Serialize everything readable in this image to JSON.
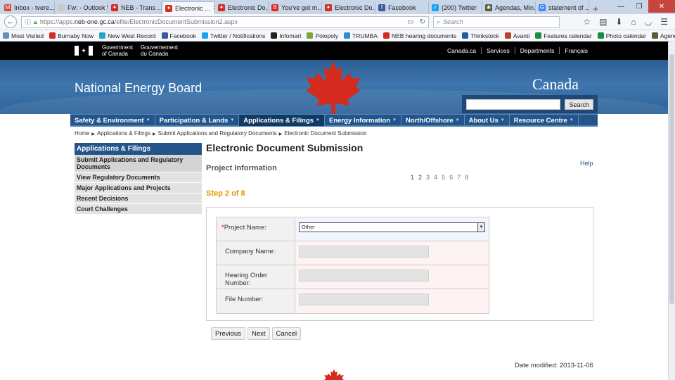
{
  "browser": {
    "tabs": [
      {
        "label": "Inbox - tvere...",
        "fav": "gmail",
        "color": "#d44638",
        "glyph": "M"
      },
      {
        "label": "Fw: - Outlook We...",
        "fav": "outlook",
        "color": "#c9c9c9",
        "glyph": ""
      },
      {
        "label": "NEB - Trans ...",
        "fav": "maple-leaf",
        "color": "#d52b1e",
        "glyph": "✦"
      },
      {
        "label": "Electronic ...",
        "fav": "maple-leaf",
        "color": "#d52b1e",
        "glyph": "✦",
        "active": true
      },
      {
        "label": "Electronic Do...",
        "fav": "maple-leaf",
        "color": "#d52b1e",
        "glyph": "✦"
      },
      {
        "label": "You've got m...",
        "fav": "mail",
        "color": "#d52b1e",
        "glyph": "B"
      },
      {
        "label": "Electronic Do...",
        "fav": "maple-leaf",
        "color": "#d52b1e",
        "glyph": "✦"
      },
      {
        "label": "Facebook",
        "fav": "facebook",
        "color": "#3b5998",
        "glyph": "f"
      },
      {
        "label": "(200) Twitter",
        "fav": "twitter",
        "color": "#1da1f2",
        "glyph": "✓"
      },
      {
        "label": "Agendas, Min...",
        "fav": "agenda",
        "color": "#5a5a3a",
        "glyph": "❀"
      },
      {
        "label": "statement of ...",
        "fav": "google",
        "color": "#4285f4",
        "glyph": "G"
      }
    ],
    "url_prefix": "https://apps.",
    "url_host": "neb-one.gc.ca",
    "url_path": "/efile/ElectronicDocumentSubmission2.aspx",
    "search_placeholder": "Search",
    "bookmarks": [
      {
        "label": "Most Visited",
        "color": "#6b8cba"
      },
      {
        "label": "Burnaby Now",
        "color": "#d52b1e"
      },
      {
        "label": "New West Record",
        "color": "#2aa0c4"
      },
      {
        "label": "Facebook",
        "color": "#3b5998"
      },
      {
        "label": "Twitter / Notifications",
        "color": "#1da1f2"
      },
      {
        "label": "Infomart",
        "color": "#222222"
      },
      {
        "label": "Polopoly",
        "color": "#7aa83a"
      },
      {
        "label": "TRUMBA",
        "color": "#2f8fce"
      },
      {
        "label": "NEB hearing documents",
        "color": "#d52b1e"
      },
      {
        "label": "Thinkstock",
        "color": "#1a5fa8"
      },
      {
        "label": "Avanti",
        "color": "#b5452d"
      },
      {
        "label": "Features calendar",
        "color": "#1e8c3a"
      },
      {
        "label": "Photo calendar",
        "color": "#1e8c3a"
      },
      {
        "label": "Agendas, Minutes & R...",
        "color": "#5a5a3a"
      }
    ]
  },
  "gc": {
    "gov_en_1": "Government",
    "gov_en_2": "of Canada",
    "gov_fr_1": "Gouvernement",
    "gov_fr_2": "du Canada",
    "links": [
      "Canada.ca",
      "Services",
      "Departments",
      "Français"
    ]
  },
  "site": {
    "title": "National Energy Board",
    "wordmark": "Canada",
    "search_button": "Search"
  },
  "menu": [
    {
      "label": "Safety & Environment",
      "active": false
    },
    {
      "label": "Participation & Lands",
      "active": false
    },
    {
      "label": "Applications & Filings",
      "active": true
    },
    {
      "label": "Energy Information",
      "active": false
    },
    {
      "label": "North/Offshore",
      "active": false
    },
    {
      "label": "About Us",
      "active": false
    },
    {
      "label": "Resource Centre",
      "active": false
    }
  ],
  "breadcrumb": [
    "Home",
    "Applications & Filings",
    "Submit Applications and Regulatory Documents",
    "Electronic Document Submission"
  ],
  "leftnav": {
    "heading": "Applications & Filings",
    "items": [
      {
        "label": "Submit Applications and Regulatory Documents",
        "current": true
      },
      {
        "label": "View Regulatory Documents"
      },
      {
        "label": "Major Applications and Projects"
      },
      {
        "label": "Recent Decisions"
      },
      {
        "label": "Court Challenges"
      }
    ]
  },
  "page": {
    "title": "Electronic Document Submission",
    "section": "Project Information",
    "help": "Help",
    "pages": [
      "1",
      "2",
      "3",
      "4",
      "5",
      "6",
      "7",
      "8"
    ],
    "current_pages": [
      "1",
      "2"
    ],
    "step": "Step 2 of 8"
  },
  "form": {
    "required_mark": "*",
    "project_name_label": "Project Name:",
    "project_name_value": "Other",
    "company_name_label": "Company Name:",
    "company_name_value": "",
    "hearing_order_label": "Hearing Order Number:",
    "hearing_order_value": "",
    "file_number_label": "File Number:",
    "file_number_value": ""
  },
  "buttons": {
    "previous": "Previous",
    "next": "Next",
    "cancel": "Cancel"
  },
  "footer": {
    "modified": "Date modified: 2013-11-06"
  },
  "colors": {
    "brand_blue": "#23558b",
    "step_orange": "#e59500",
    "leaf_red": "#d52b1e"
  }
}
